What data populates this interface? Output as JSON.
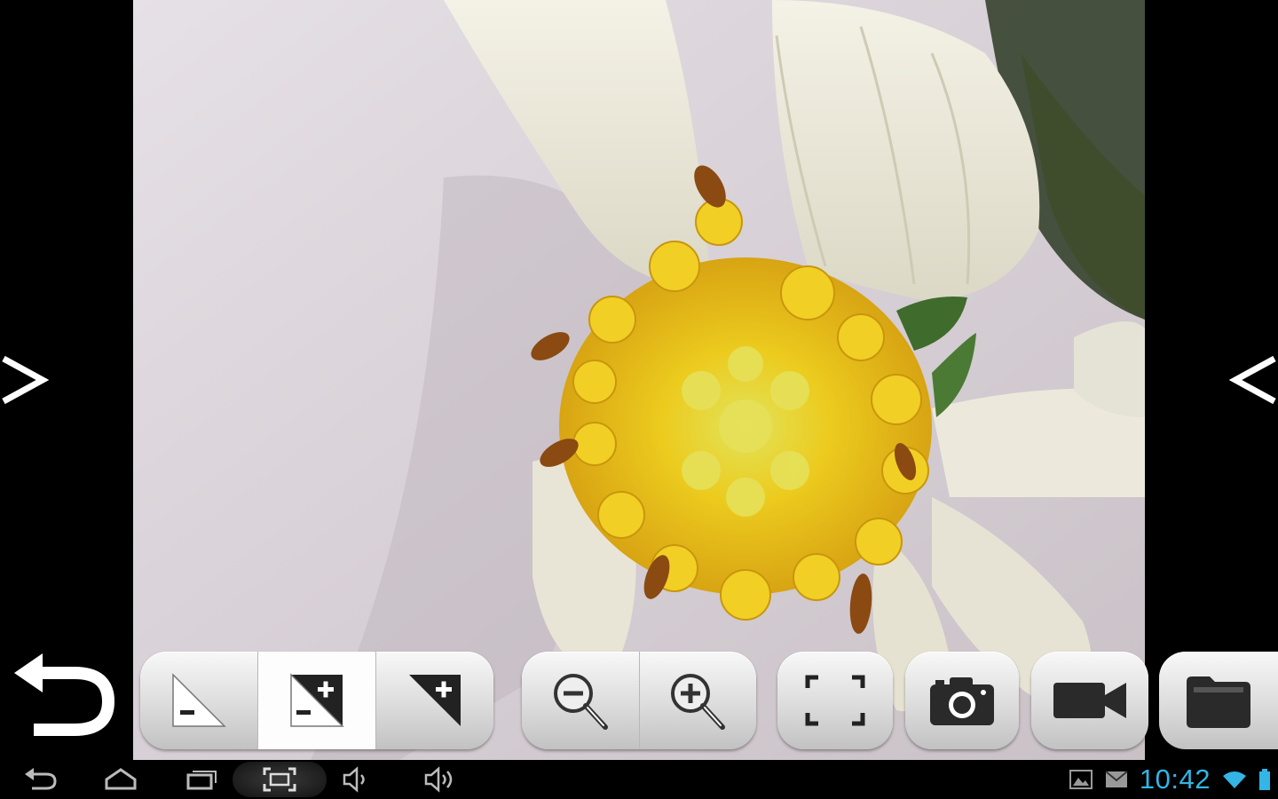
{
  "photo": {
    "subject": "flower-photo"
  },
  "navigation": {
    "prev_arrow": "chevron-right-icon",
    "next_arrow": "chevron-left-icon",
    "back": "undo-arrow-icon"
  },
  "toolbar": {
    "contrast_group": [
      {
        "icon": "contrast-minus-icon",
        "active": false
      },
      {
        "icon": "contrast-plus-minus-icon",
        "active": true
      },
      {
        "icon": "contrast-plus-icon",
        "active": false
      }
    ],
    "zoom_group": [
      {
        "icon": "zoom-out-icon"
      },
      {
        "icon": "zoom-in-icon"
      }
    ],
    "fullscreen": {
      "icon": "fullscreen-icon"
    },
    "camera": {
      "icon": "camera-icon"
    },
    "video": {
      "icon": "video-camera-icon"
    },
    "folder": {
      "icon": "folder-icon"
    }
  },
  "system_bar": {
    "buttons": [
      "back-icon",
      "home-icon",
      "recent-apps-icon",
      "screenshot-icon",
      "volume-down-icon",
      "volume-up-icon"
    ],
    "time": "10:42",
    "time_color": "#33b5e5",
    "notifications": [
      "gallery-icon",
      "gmail-icon"
    ],
    "indicators": [
      "wifi-icon",
      "battery-icon"
    ]
  }
}
